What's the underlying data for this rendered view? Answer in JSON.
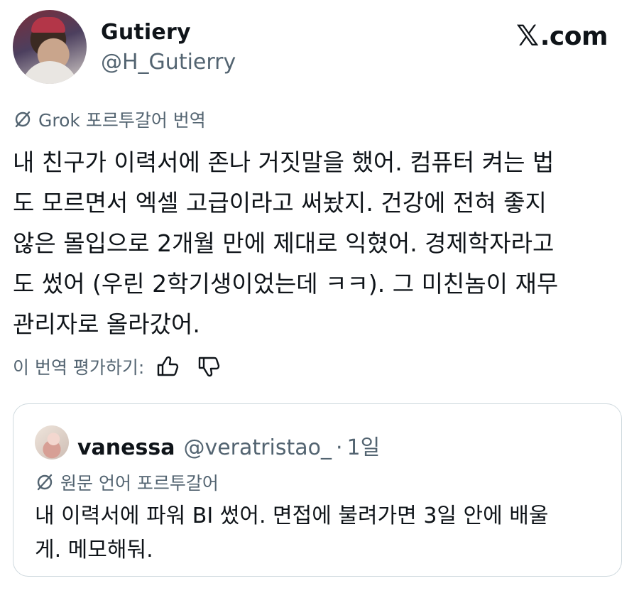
{
  "brand": {
    "label": ".com"
  },
  "author": {
    "name": "Gutiery",
    "handle": "@H_Gutierry"
  },
  "translation": {
    "label": "Grok 포르투갈어 번역"
  },
  "post": {
    "lines": [
      "내 친구가 이력서에 존나 거짓말을 했어. 컴퓨터 켜는 법",
      "도 모르면서 엑셀 고급이라고 써놨지. 건강에 전혀 좋지",
      "않은 몰입으로 2개월 만에 제대로 익혔어. 경제학자라고",
      "도 썼어 (우린 2학기생이었는데 ㅋㅋ). 그 미친놈이 재무",
      "관리자로 올라갔어."
    ]
  },
  "rating": {
    "label": "이 번역 평가하기:"
  },
  "quote": {
    "name": "vanessa",
    "handle": "@veratristao_",
    "dot": "·",
    "time": "1일",
    "lang_label": "원문 언어 포르투갈어",
    "lines": [
      "내 이력서에 파워 BI 썼어. 면접에 불려가면 3일 안에 배울",
      "게. 메모해둬."
    ]
  },
  "icons": {
    "x_logo": "x-logo-icon",
    "translate": "slashed-circle-icon",
    "thumbs_up": "thumbs-up-icon",
    "thumbs_down": "thumbs-down-icon"
  },
  "colors": {
    "text": "#0f1419",
    "secondary": "#536471",
    "border": "#cfd9de"
  }
}
